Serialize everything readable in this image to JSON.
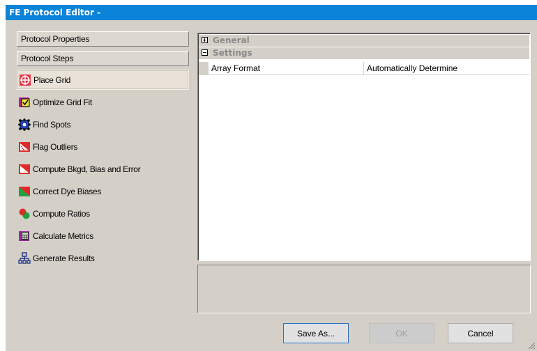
{
  "window": {
    "title": "FE Protocol Editor -"
  },
  "sidebar": {
    "sections": [
      {
        "label": "Protocol Properties"
      },
      {
        "label": "Protocol Steps"
      }
    ],
    "steps": [
      {
        "label": "Place Grid",
        "icon": "place-grid-icon",
        "selected": true
      },
      {
        "label": "Optimize Grid Fit",
        "icon": "optimize-grid-fit-icon"
      },
      {
        "label": "Find Spots",
        "icon": "find-spots-icon"
      },
      {
        "label": "Flag Outliers",
        "icon": "flag-outliers-icon"
      },
      {
        "label": "Compute Bkgd, Bias and Error",
        "icon": "compute-bkgd-icon"
      },
      {
        "label": "Correct Dye Biases",
        "icon": "correct-dye-biases-icon"
      },
      {
        "label": "Compute Ratios",
        "icon": "compute-ratios-icon"
      },
      {
        "label": "Calculate Metrics",
        "icon": "calculate-metrics-icon"
      },
      {
        "label": "Generate Results",
        "icon": "generate-results-icon"
      }
    ]
  },
  "property_grid": {
    "categories": [
      {
        "label": "General",
        "expanded": false
      },
      {
        "label": "Settings",
        "expanded": true
      }
    ],
    "rows": [
      {
        "name": "Array Format",
        "value": "Automatically Determine"
      }
    ]
  },
  "buttons": {
    "save_as": "Save As...",
    "ok": "OK",
    "cancel": "Cancel"
  },
  "colors": {
    "titlebar": "#0a84d8",
    "window_bg": "#d4d0c8"
  }
}
